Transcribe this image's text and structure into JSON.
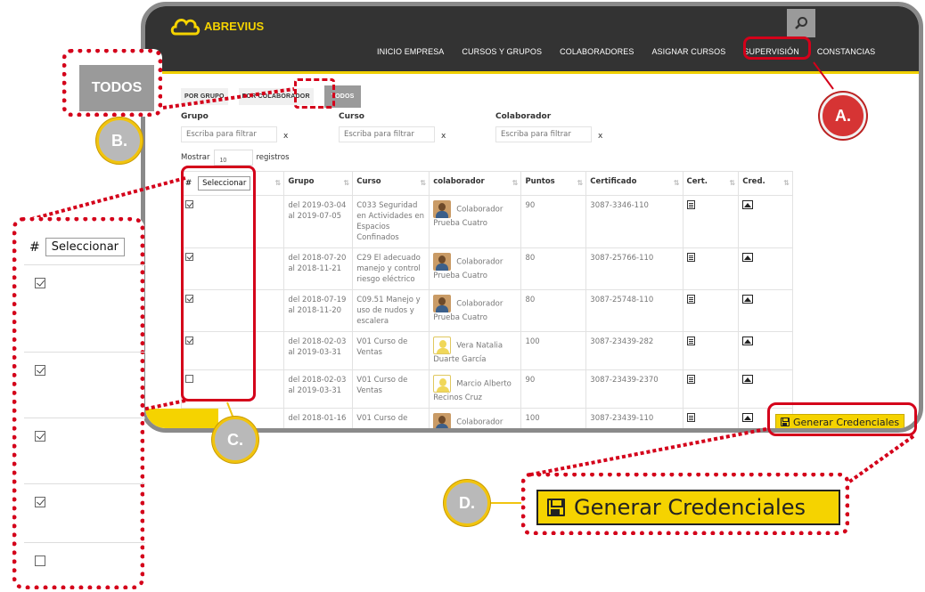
{
  "app": {
    "logo_text": "ABREVIUS"
  },
  "nav": {
    "items": [
      "INICIO EMPRESA",
      "CURSOS Y GRUPOS",
      "COLABORADORES",
      "ASIGNAR CURSOS",
      "SUPERVISIÓN",
      "CONSTANCIAS"
    ],
    "active": "CONSTANCIAS"
  },
  "segments": {
    "por_grupo": "POR GRUPO",
    "por_colaborador": "POR COLABORADOR",
    "todos": "TODOS"
  },
  "filters": {
    "grupo_label": "Grupo",
    "curso_label": "Curso",
    "colaborador_label": "Colaborador",
    "placeholder": "Escriba para filtrar",
    "clear": "x"
  },
  "show": {
    "prefix": "Mostrar",
    "value": "10",
    "suffix": "registros"
  },
  "table": {
    "headers": [
      "#",
      "Grupo",
      "Curso",
      "colaborador",
      "Puntos",
      "Certificado",
      "Cert.",
      "Cred."
    ],
    "select_button": "Seleccionar",
    "rows": [
      {
        "checked": true,
        "grupo": "del 2019-03-04 al 2019-07-05",
        "curso": "C033 Seguridad en Actividades en Espacios Confinados",
        "colaborador": "Colaborador Prueba Cuatro",
        "photo": "person-photo",
        "puntos": "90",
        "certificado": "3087-3346-110"
      },
      {
        "checked": true,
        "grupo": "del 2018-07-20 al 2018-11-21",
        "curso": "C29 El adecuado manejo y control riesgo eléctrico",
        "colaborador": "Colaborador Prueba Cuatro",
        "photo": "person-photo",
        "puntos": "80",
        "certificado": "3087-25766-110"
      },
      {
        "checked": true,
        "grupo": "del 2018-07-19 al 2018-11-20",
        "curso": "C09.51 Manejo y uso de nudos y escalera",
        "colaborador": "Colaborador Prueba Cuatro",
        "photo": "person-photo",
        "puntos": "80",
        "certificado": "3087-25748-110"
      },
      {
        "checked": true,
        "grupo": "del 2018-02-03 al 2019-03-31",
        "curso": "V01 Curso de Ventas",
        "colaborador": "Vera Natalia Duarte García",
        "photo": "generic-avatar",
        "puntos": "100",
        "certificado": "3087-23439-282"
      },
      {
        "checked": false,
        "grupo": "del 2018-02-03 al 2019-03-31",
        "curso": "V01 Curso de Ventas",
        "colaborador": "Marcio Alberto Recinos Cruz",
        "photo": "generic-avatar",
        "puntos": "90",
        "certificado": "3087-23439-2370"
      },
      {
        "checked": null,
        "grupo": "del 2018-01-16",
        "curso": "V01 Curso de",
        "colaborador": "Colaborador",
        "photo": "person-photo",
        "puntos": "100",
        "certificado": "3087-23439-110"
      }
    ]
  },
  "generate_button": "Generar Credenciales",
  "annotations": {
    "a": "A.",
    "b": "B.",
    "c": "C.",
    "d": "D.",
    "zoom_todos": "TODOS",
    "zoom_select": {
      "hash": "#",
      "button": "Seleccionar",
      "checks": [
        true,
        true,
        true,
        true,
        false
      ]
    },
    "zoom_generate": "Generar Credenciales",
    "highlight_color": "#d4001a",
    "accent": "#f5d300"
  }
}
